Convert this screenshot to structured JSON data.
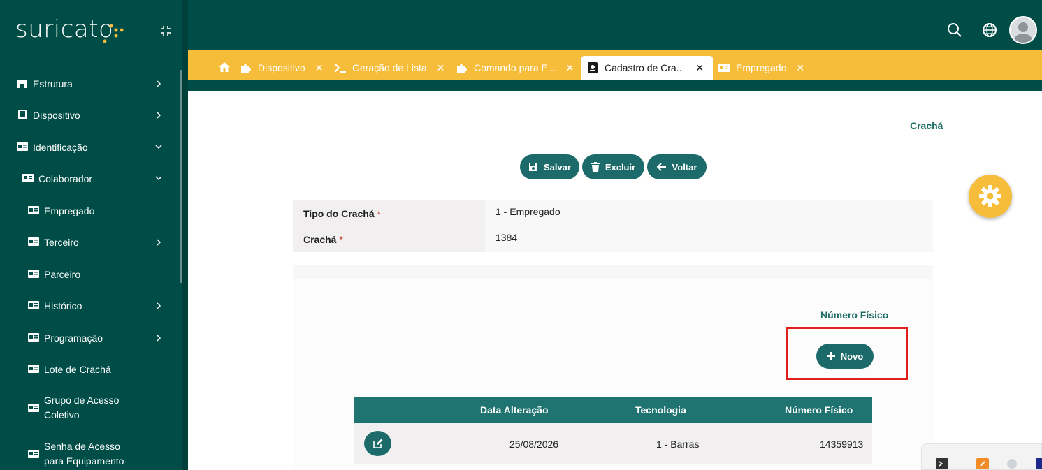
{
  "app": {
    "logo_text": "suricato"
  },
  "sidebar": {
    "items": [
      {
        "label": "Estrutura",
        "icon": "building-icon",
        "chevron": "right"
      },
      {
        "label": "Dispositivo",
        "icon": "device-icon",
        "chevron": "right"
      },
      {
        "label": "Identificação",
        "icon": "id-card-icon",
        "chevron": "down"
      },
      {
        "label": "Colaborador",
        "icon": "id-card-icon",
        "chevron": "down"
      },
      {
        "label": "Empregado",
        "icon": "id-card-icon",
        "chevron": ""
      },
      {
        "label": "Terceiro",
        "icon": "id-card-icon",
        "chevron": "right"
      },
      {
        "label": "Parceiro",
        "icon": "id-card-icon",
        "chevron": ""
      },
      {
        "label": "Histórico",
        "icon": "id-card-icon",
        "chevron": "right"
      },
      {
        "label": "Programação",
        "icon": "id-card-icon",
        "chevron": "right"
      },
      {
        "label": "Lote de Crachá",
        "icon": "id-card-icon",
        "chevron": ""
      },
      {
        "label_line1": "Grupo de Acesso",
        "label_line2": "Coletivo",
        "icon": "id-card-icon",
        "chevron": ""
      },
      {
        "label_line1": "Senha de Acesso",
        "label_line2": "para Equipamento",
        "icon": "id-card-icon",
        "chevron": ""
      }
    ]
  },
  "tabs": [
    {
      "label": "Dispositivo",
      "close": "✕"
    },
    {
      "label": "Geração de Lista",
      "close": "✕"
    },
    {
      "label": "Comando para E...",
      "close": "✕"
    },
    {
      "label": "Cadastro de Cra...",
      "close": "✕"
    },
    {
      "label": "Empregado",
      "close": "✕"
    }
  ],
  "page": {
    "title": "Crachá",
    "buttons": {
      "save": "Salvar",
      "delete": "Excluir",
      "back": "Voltar"
    },
    "form": {
      "tipo_label": "Tipo do Crachá",
      "tipo_value": "1 - Empregado",
      "cracha_label": "Crachá",
      "cracha_value": "1384",
      "required_mark": "*"
    },
    "numero_fisico": {
      "title": "Número Físico",
      "new_button": "Novo",
      "columns": [
        "Data Alteração",
        "Tecnologia",
        "Número Físico"
      ],
      "rows": [
        {
          "data_alteracao": "25/08/2026",
          "tecnologia": "1 - Barras",
          "numero_fisico": "14359913"
        }
      ]
    }
  },
  "colors": {
    "primary_dark": "#004d47",
    "accent_yellow": "#f6bd3b",
    "button_teal": "#1c6b6a",
    "highlight_red": "#e0201c"
  }
}
